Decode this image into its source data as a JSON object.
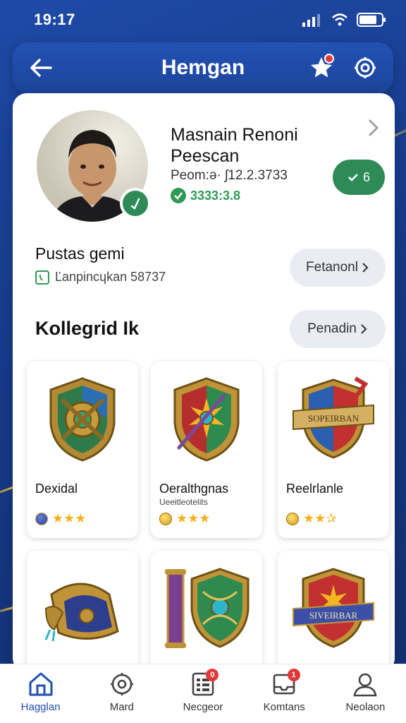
{
  "status_bar": {
    "time": "19:17"
  },
  "header": {
    "title": "Hemgan"
  },
  "profile": {
    "name": "Masnain Renoni Peescan",
    "id_text": "Peom:ə· ʃ12.2.3733",
    "verified_text": "3333:3.8",
    "level_text": "6"
  },
  "status_section": {
    "title": "Pustas gemi",
    "subtitle": "Ľanpincɥkan 58737",
    "button_label": "Fetanonl"
  },
  "collection": {
    "title": "Kollegrid Ik",
    "button_label": "Penadin",
    "items": [
      {
        "name": "Dexidal",
        "sub": "",
        "rating": "★★★",
        "icon": "compass-shield-icon"
      },
      {
        "name": "Oeralthgnas",
        "sub": "Ueeitleotelits",
        "rating": "★★★",
        "icon": "sun-shield-icon"
      },
      {
        "name": "Reelrlanle",
        "sub": "",
        "rating": "★★✰",
        "icon": "banner-shield-icon"
      },
      {
        "name": "",
        "sub": "",
        "rating": "",
        "icon": "bracer-icon"
      },
      {
        "name": "",
        "sub": "",
        "rating": "",
        "icon": "scroll-shield-icon"
      },
      {
        "name": "",
        "sub": "",
        "rating": "",
        "icon": "red-banner-shield-icon"
      }
    ],
    "item_banners": {
      "banner_shield": "SOPEIRBAN",
      "red_banner_shield": "SIVEIRBAR"
    }
  },
  "tabbar": {
    "tabs": [
      {
        "label": "Hagglan",
        "icon": "home-icon",
        "active": true,
        "badge": ""
      },
      {
        "label": "Mard",
        "icon": "gear-flower-icon",
        "active": false,
        "badge": ""
      },
      {
        "label": "Necgeor",
        "icon": "list-icon",
        "active": false,
        "badge": "0"
      },
      {
        "label": "Komtans",
        "icon": "inbox-icon",
        "active": false,
        "badge": "1"
      },
      {
        "label": "Neolaon",
        "icon": "user-icon",
        "active": false,
        "badge": ""
      }
    ]
  },
  "colors": {
    "brand": "#1f4fb0",
    "accent_green": "#2e8b57",
    "badge_red": "#e23a3a"
  }
}
